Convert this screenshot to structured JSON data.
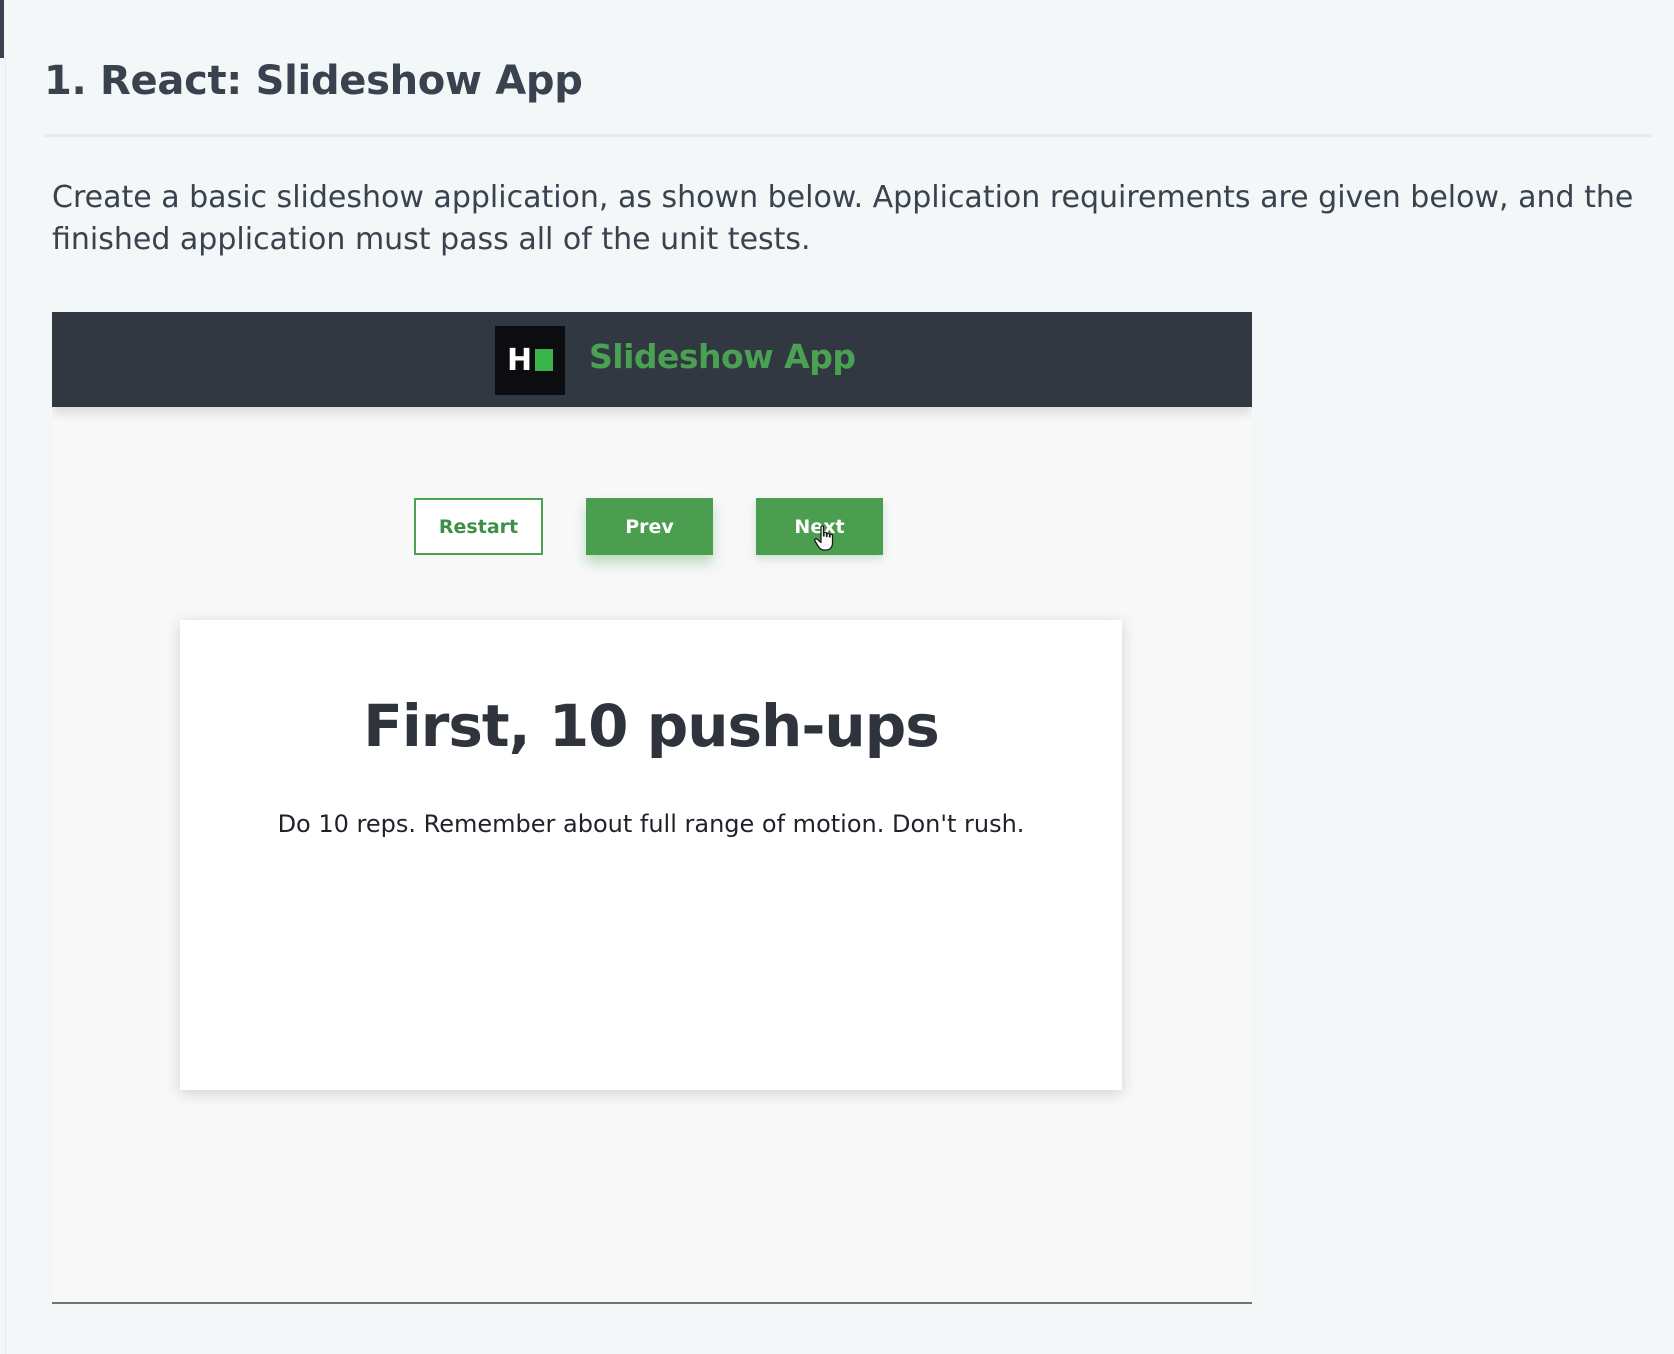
{
  "problem": {
    "title": "1. React: Slideshow App",
    "description": "Create a basic slideshow application, as shown below. Application requirements are given below, and the finished application must pass all of the unit tests."
  },
  "preview": {
    "header": {
      "logo_letter": "H",
      "app_title": "Slideshow App"
    },
    "buttons": {
      "restart": "Restart",
      "prev": "Prev",
      "next": "Next"
    },
    "slide": {
      "title": "First, 10 push-ups",
      "text": "Do 10 reps. Remember about full range of motion. Don't rush."
    },
    "icons": {
      "logo": "hackerrank-logo-icon",
      "cursor": "hand-pointer-cursor-icon"
    },
    "colors": {
      "accent_green": "#4aa152",
      "header_bg": "#323842",
      "page_bg": "#f3f7f7"
    }
  }
}
